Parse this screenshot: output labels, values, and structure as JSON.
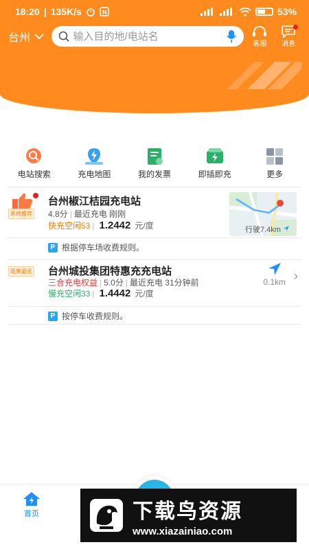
{
  "status_bar": {
    "time": "18:20",
    "speed": "135K/s",
    "battery": "53%"
  },
  "header": {
    "city": "台州",
    "search_placeholder": "输入目的地/电站名",
    "service_label": "客服",
    "message_label": "消息"
  },
  "quick_nav": [
    {
      "label": "电站搜索",
      "icon": "station-search-icon"
    },
    {
      "label": "充电地图",
      "icon": "charging-map-icon"
    },
    {
      "label": "我的发票",
      "icon": "invoice-icon"
    },
    {
      "label": "即插即充",
      "icon": "plug-and-charge-icon"
    },
    {
      "label": "更多",
      "icon": "more-grid-icon"
    }
  ],
  "stations": [
    {
      "tag": "系统推荐",
      "name": "台州椒江桔园充电站",
      "score": "4.8分",
      "recent": "最近充电 刚刚",
      "idle": "快充空闲53",
      "price": "1.2442",
      "unit": "元/度",
      "distance": "行驶7.4km",
      "note": "根据停车场收费规则。"
    },
    {
      "tag": "距离最近",
      "name": "台州城投集团特惠充充电站",
      "rights": "三合充电权益",
      "score": "5.0分",
      "recent": "最近充电 31分钟前",
      "idle": "慢充空闲33",
      "price": "1.4442",
      "unit": "元/度",
      "distance": "0.1km",
      "note": "按停车收费规则。"
    }
  ],
  "tabbar": {
    "home_label": "首页"
  },
  "watermark": {
    "title": "下载鸟资源",
    "url": "www.xiazainiao.com"
  },
  "colors": {
    "brand_orange": "#ff8a1e",
    "fast_orange": "#ff7a00",
    "slow_green": "#2bb06a",
    "accent_blue": "#1e90ff"
  }
}
